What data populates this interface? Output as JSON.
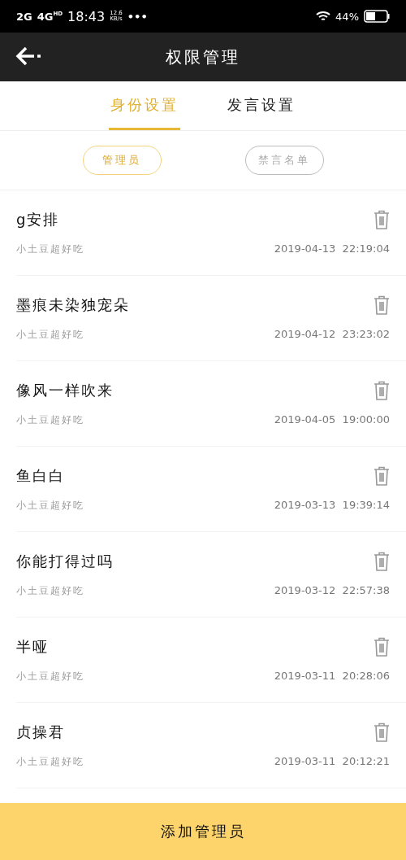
{
  "status_bar": {
    "network_1": "2G",
    "network_2": "4G",
    "network_2_badge": "HD",
    "time": "18:43",
    "speed": "12.6",
    "speed_unit": "KB/s",
    "more": "•••",
    "battery": "44%"
  },
  "header": {
    "title": "权限管理"
  },
  "tabs": [
    {
      "label": "身份设置",
      "selected": true
    },
    {
      "label": "发言设置",
      "selected": false
    }
  ],
  "filters": [
    {
      "label": "管理员",
      "selected": true
    },
    {
      "label": "禁言名单",
      "selected": false
    }
  ],
  "members": [
    {
      "name": "g安排",
      "added_by": "小土豆超好吃",
      "time": "2019-04-13  22:19:04"
    },
    {
      "name": "墨痕未染独宠朵",
      "added_by": "小土豆超好吃",
      "time": "2019-04-12  23:23:02"
    },
    {
      "name": "像风一样吹来",
      "added_by": "小土豆超好吃",
      "time": "2019-04-05  19:00:00"
    },
    {
      "name": "鱼白白",
      "added_by": "小土豆超好吃",
      "time": "2019-03-13  19:39:14"
    },
    {
      "name": "你能打得过吗",
      "added_by": "小土豆超好吃",
      "time": "2019-03-12  22:57:38"
    },
    {
      "name": "半哑",
      "added_by": "小土豆超好吃",
      "time": "2019-03-11  20:28:06"
    },
    {
      "name": "贞操君",
      "added_by": "小土豆超好吃",
      "time": "2019-03-11  20:12:21"
    }
  ],
  "add_button": "添加管理员"
}
